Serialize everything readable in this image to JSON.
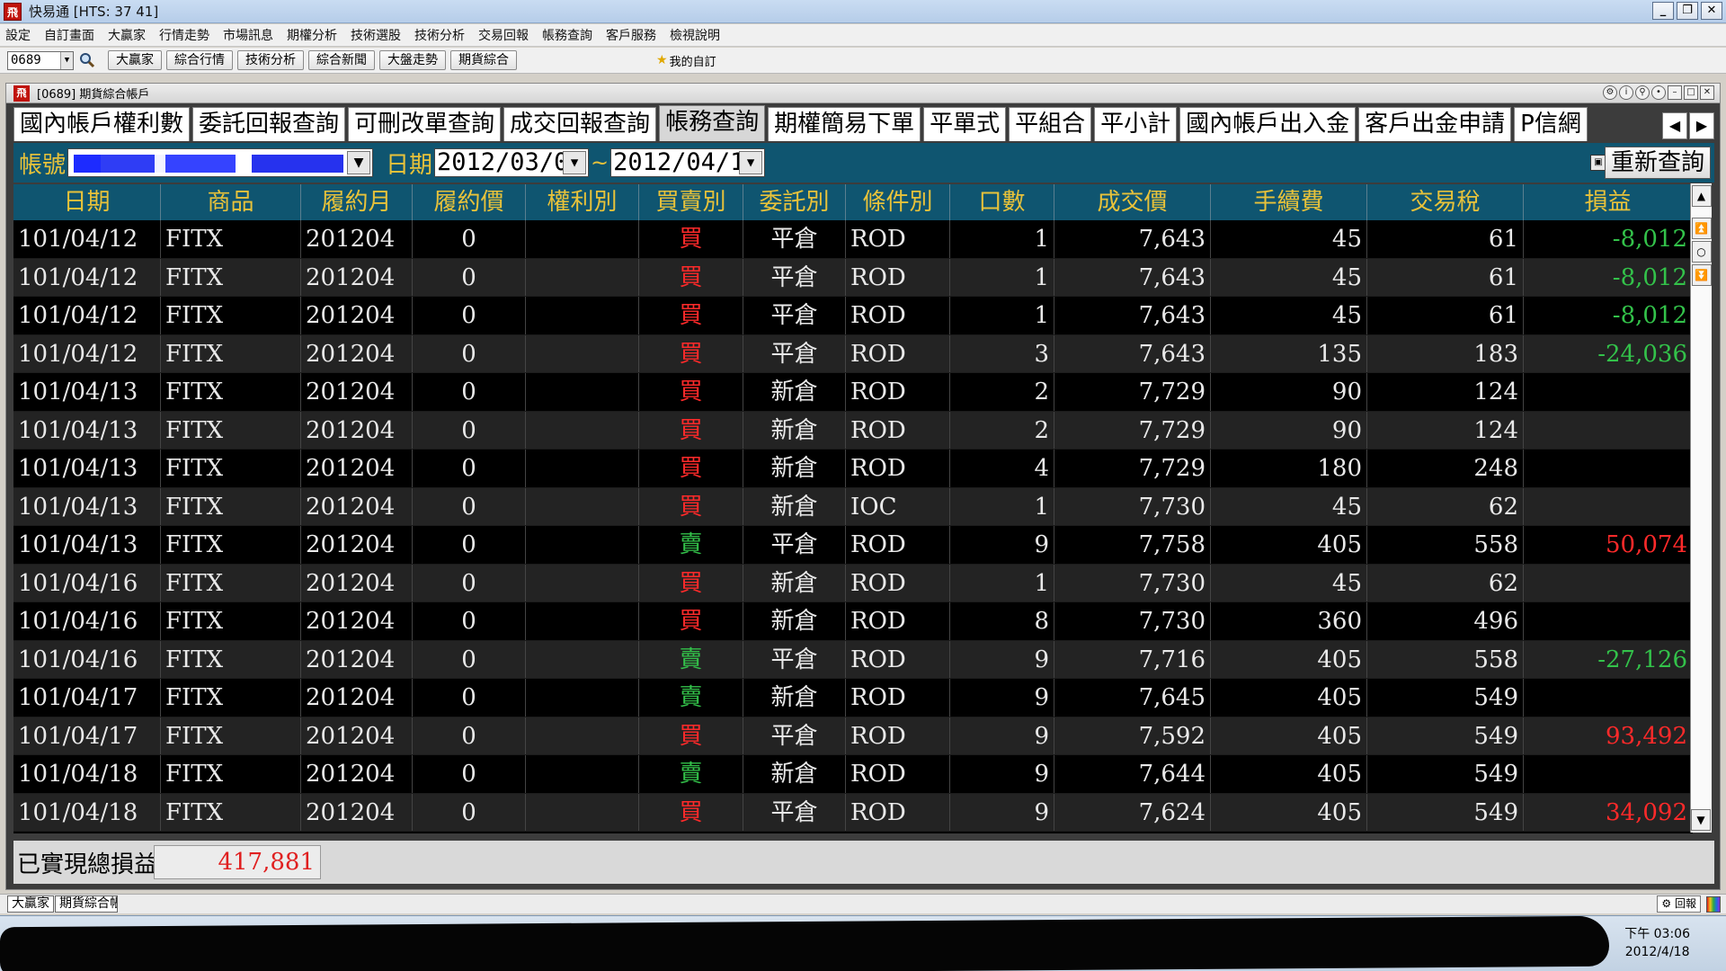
{
  "window": {
    "title": "快易通 [HTS: 37 41]"
  },
  "menu": [
    "設定",
    "自訂畫面",
    "大贏家",
    "行情走勢",
    "市場訊息",
    "期權分析",
    "技術選股",
    "技術分析",
    "交易回報",
    "帳務查詢",
    "客戶服務",
    "檢視說明"
  ],
  "toolbar": {
    "code": "0689",
    "buttons": [
      "大贏家",
      "綜合行情",
      "技術分析",
      "綜合新聞",
      "大盤走勢",
      "期貨綜合"
    ],
    "favorites": "我的自訂"
  },
  "child": {
    "title": "[0689] 期貨綜合帳戶"
  },
  "tabs": [
    "國內帳戶權利數",
    "委託回報查詢",
    "可刪改單查詢",
    "成交回報查詢",
    "帳務查詢",
    "期權簡易下單",
    "平單式",
    "平組合",
    "平小計",
    "國內帳戶出入金",
    "客戶出金申請",
    "P信網"
  ],
  "active_tab": "帳務查詢",
  "query": {
    "account_label": "帳號",
    "date_label": "日期",
    "date_from": "2012/03/0",
    "tilde": "~",
    "date_to": "2012/04/1",
    "requery": "重新查詢"
  },
  "table": {
    "headers": [
      "日期",
      "商品",
      "履約月",
      "履約價",
      "權利別",
      "買賣別",
      "委託別",
      "條件別",
      "口數",
      "成交價",
      "手續費",
      "交易稅",
      "損益"
    ],
    "rows": [
      [
        "101/04/12",
        "FITX",
        "201204",
        "0",
        "",
        "買",
        "平倉",
        "ROD",
        "1",
        "7,643",
        "45",
        "61",
        "-8,012"
      ],
      [
        "101/04/12",
        "FITX",
        "201204",
        "0",
        "",
        "買",
        "平倉",
        "ROD",
        "1",
        "7,643",
        "45",
        "61",
        "-8,012"
      ],
      [
        "101/04/12",
        "FITX",
        "201204",
        "0",
        "",
        "買",
        "平倉",
        "ROD",
        "1",
        "7,643",
        "45",
        "61",
        "-8,012"
      ],
      [
        "101/04/12",
        "FITX",
        "201204",
        "0",
        "",
        "買",
        "平倉",
        "ROD",
        "3",
        "7,643",
        "135",
        "183",
        "-24,036"
      ],
      [
        "101/04/13",
        "FITX",
        "201204",
        "0",
        "",
        "買",
        "新倉",
        "ROD",
        "2",
        "7,729",
        "90",
        "124",
        ""
      ],
      [
        "101/04/13",
        "FITX",
        "201204",
        "0",
        "",
        "買",
        "新倉",
        "ROD",
        "2",
        "7,729",
        "90",
        "124",
        ""
      ],
      [
        "101/04/13",
        "FITX",
        "201204",
        "0",
        "",
        "買",
        "新倉",
        "ROD",
        "4",
        "7,729",
        "180",
        "248",
        ""
      ],
      [
        "101/04/13",
        "FITX",
        "201204",
        "0",
        "",
        "買",
        "新倉",
        "IOC",
        "1",
        "7,730",
        "45",
        "62",
        ""
      ],
      [
        "101/04/13",
        "FITX",
        "201204",
        "0",
        "",
        "賣",
        "平倉",
        "ROD",
        "9",
        "7,758",
        "405",
        "558",
        "50,074"
      ],
      [
        "101/04/16",
        "FITX",
        "201204",
        "0",
        "",
        "買",
        "新倉",
        "ROD",
        "1",
        "7,730",
        "45",
        "62",
        ""
      ],
      [
        "101/04/16",
        "FITX",
        "201204",
        "0",
        "",
        "買",
        "新倉",
        "ROD",
        "8",
        "7,730",
        "360",
        "496",
        ""
      ],
      [
        "101/04/16",
        "FITX",
        "201204",
        "0",
        "",
        "賣",
        "平倉",
        "ROD",
        "9",
        "7,716",
        "405",
        "558",
        "-27,126"
      ],
      [
        "101/04/17",
        "FITX",
        "201204",
        "0",
        "",
        "賣",
        "新倉",
        "ROD",
        "9",
        "7,645",
        "405",
        "549",
        ""
      ],
      [
        "101/04/17",
        "FITX",
        "201204",
        "0",
        "",
        "買",
        "平倉",
        "ROD",
        "9",
        "7,592",
        "405",
        "549",
        "93,492"
      ],
      [
        "101/04/18",
        "FITX",
        "201204",
        "0",
        "",
        "賣",
        "新倉",
        "ROD",
        "9",
        "7,644",
        "405",
        "549",
        ""
      ],
      [
        "101/04/18",
        "FITX",
        "201204",
        "0",
        "",
        "買",
        "平倉",
        "ROD",
        "9",
        "7,624",
        "405",
        "549",
        "34,092"
      ]
    ]
  },
  "footer": {
    "label": "已實現總損益",
    "value": "417,881"
  },
  "strip": {
    "buttons": [
      "大贏家",
      "期貨綜合帳"
    ],
    "report": "回報"
  },
  "clock": {
    "time": "下午 03:06",
    "date": "2012/4/18"
  },
  "colors": {
    "buy": "#ff2a2a",
    "sell": "#33c24a",
    "header_bg": "#0f5570",
    "header_text": "#e8c23a"
  },
  "icons": {
    "search": "magnifier-icon",
    "favorite": "star-icon"
  }
}
